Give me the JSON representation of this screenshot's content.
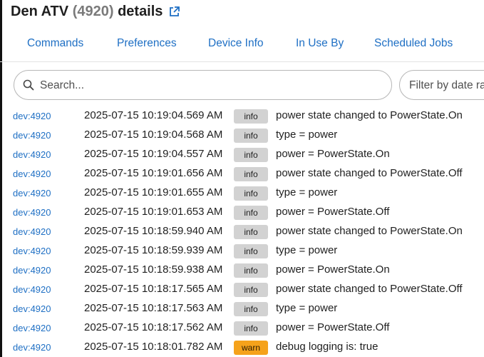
{
  "header": {
    "name": "Den ATV",
    "id_text": "(4920)",
    "suffix": "details",
    "external_link_icon": "external-link-icon"
  },
  "tabs": [
    {
      "label": "Commands"
    },
    {
      "label": "Preferences"
    },
    {
      "label": "Device Info"
    },
    {
      "label": "In Use By"
    },
    {
      "label": "Scheduled Jobs"
    }
  ],
  "search": {
    "placeholder": "Search...",
    "icon": "search-icon"
  },
  "filter": {
    "placeholder": "Filter by date range"
  },
  "colors": {
    "link": "#1e6fc4",
    "info_badge": "#d2d2d2",
    "warn_badge": "#f5a21b"
  },
  "logs": [
    {
      "device": "dev:4920",
      "timestamp": "2025-07-15 10:19:04.569 AM",
      "level": "info",
      "message": "power state changed to PowerState.On"
    },
    {
      "device": "dev:4920",
      "timestamp": "2025-07-15 10:19:04.568 AM",
      "level": "info",
      "message": "type = power"
    },
    {
      "device": "dev:4920",
      "timestamp": "2025-07-15 10:19:04.557 AM",
      "level": "info",
      "message": "power = PowerState.On"
    },
    {
      "device": "dev:4920",
      "timestamp": "2025-07-15 10:19:01.656 AM",
      "level": "info",
      "message": "power state changed to PowerState.Off"
    },
    {
      "device": "dev:4920",
      "timestamp": "2025-07-15 10:19:01.655 AM",
      "level": "info",
      "message": "type = power"
    },
    {
      "device": "dev:4920",
      "timestamp": "2025-07-15 10:19:01.653 AM",
      "level": "info",
      "message": "power = PowerState.Off"
    },
    {
      "device": "dev:4920",
      "timestamp": "2025-07-15 10:18:59.940 AM",
      "level": "info",
      "message": "power state changed to PowerState.On"
    },
    {
      "device": "dev:4920",
      "timestamp": "2025-07-15 10:18:59.939 AM",
      "level": "info",
      "message": "type = power"
    },
    {
      "device": "dev:4920",
      "timestamp": "2025-07-15 10:18:59.938 AM",
      "level": "info",
      "message": "power = PowerState.On"
    },
    {
      "device": "dev:4920",
      "timestamp": "2025-07-15 10:18:17.565 AM",
      "level": "info",
      "message": "power state changed to PowerState.Off"
    },
    {
      "device": "dev:4920",
      "timestamp": "2025-07-15 10:18:17.563 AM",
      "level": "info",
      "message": "type = power"
    },
    {
      "device": "dev:4920",
      "timestamp": "2025-07-15 10:18:17.562 AM",
      "level": "info",
      "message": "power = PowerState.Off"
    },
    {
      "device": "dev:4920",
      "timestamp": "2025-07-15 10:18:01.782 AM",
      "level": "warn",
      "message": "debug logging is: true"
    }
  ]
}
